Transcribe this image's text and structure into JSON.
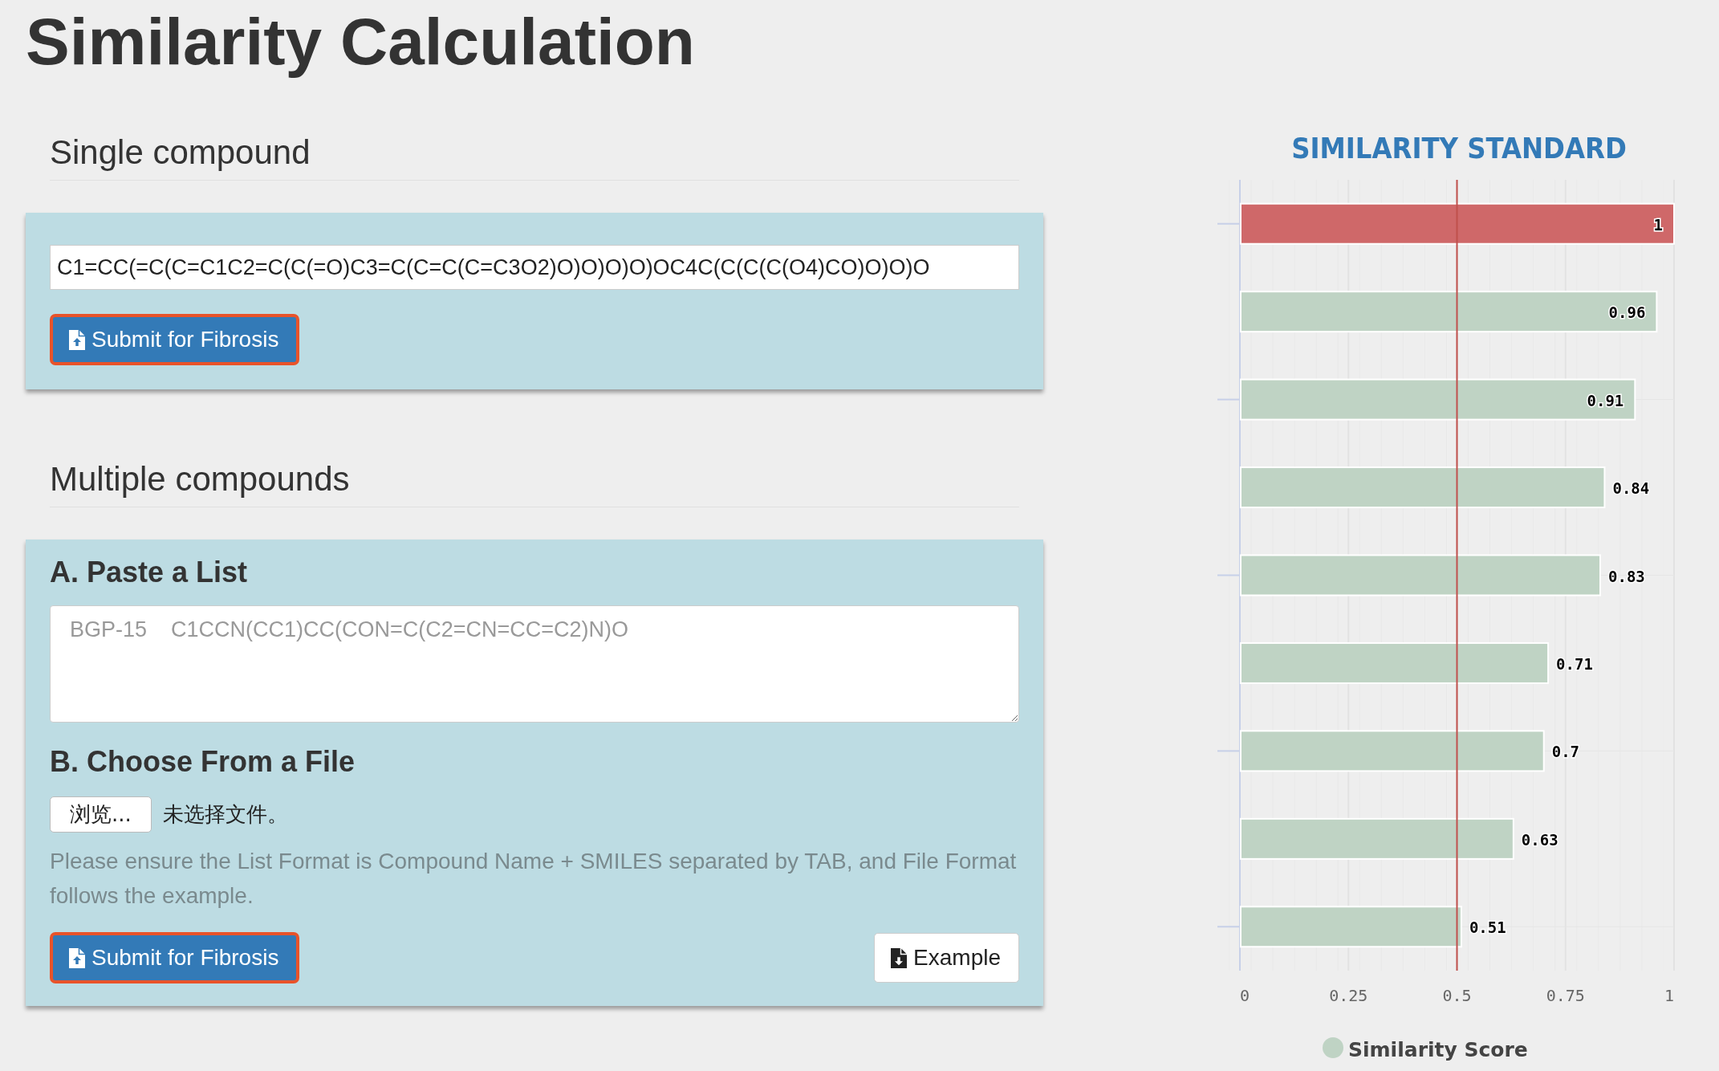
{
  "page_title": "Similarity Calculation",
  "single": {
    "heading": "Single compound",
    "smiles_value": "C1=CC(=C(C=C1C2=C(C(=O)C3=C(C=C(C=C3O2)O)O)O)O)OC4C(C(C(C(O4)CO)O)O)O",
    "submit_label": "Submit for Fibrosis"
  },
  "multiple": {
    "heading": "Multiple compounds",
    "paste_heading": "A. Paste a List",
    "paste_placeholder": "BGP-15    C1CCN(CC1)CC(CON=C(C2=CN=CC=C2)N)O",
    "file_heading": "B. Choose From a File",
    "browse_label": "浏览...",
    "file_status": "未选择文件。",
    "help_text": "Please ensure the List Format is Compound Name + SMILES separated by TAB, and File Format follows the example.",
    "submit_label": "Submit for Fibrosis",
    "example_label": "Example"
  },
  "chart": {
    "chart_data": {
      "type": "bar",
      "orientation": "horizontal",
      "title": "SIMILARITY STANDARD",
      "series": [
        {
          "name": "Similarity Score",
          "color": "#bfd3c4",
          "values": [
            null,
            0.96,
            0.91,
            0.84,
            0.83,
            0.71,
            0.7,
            0.63,
            0.51
          ]
        },
        {
          "color": "#cf6869",
          "values": [
            1,
            null,
            null,
            null,
            null,
            null,
            null,
            null,
            null
          ]
        }
      ],
      "xlim": [
        0,
        1
      ],
      "xticks": [
        0,
        0.25,
        0.5,
        0.75,
        1
      ],
      "data_labels": true,
      "grid": true,
      "ref_lines": [
        {
          "axis": "x",
          "value": 0.5
        }
      ]
    }
  }
}
